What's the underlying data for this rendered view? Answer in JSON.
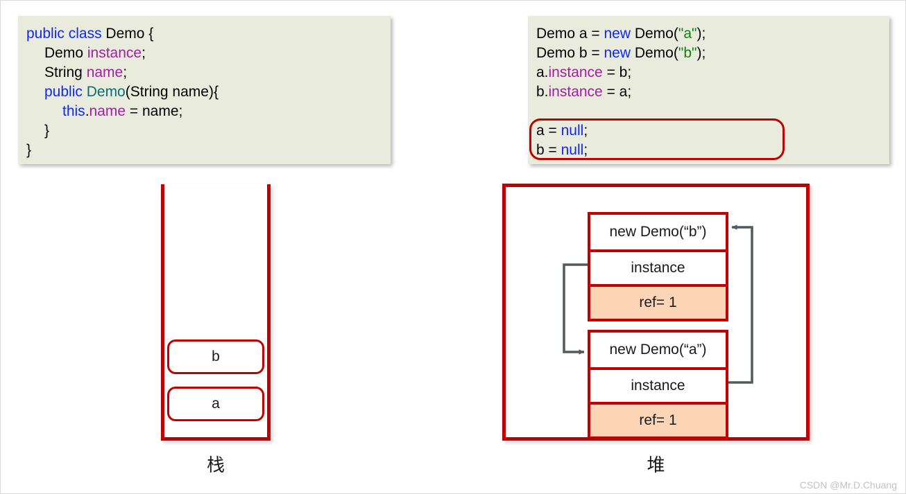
{
  "code_left": {
    "name": "demo-class-definition",
    "lines": [
      {
        "indent": 0,
        "tokens": [
          {
            "t": "public",
            "c": "kw"
          },
          {
            "t": " ",
            "c": ""
          },
          {
            "t": "class",
            "c": "kw"
          },
          {
            "t": " Demo {",
            "c": ""
          }
        ]
      },
      {
        "indent": 1,
        "tokens": [
          {
            "t": "Demo ",
            "c": ""
          },
          {
            "t": "instance",
            "c": "fld"
          },
          {
            "t": ";",
            "c": ""
          }
        ]
      },
      {
        "indent": 1,
        "tokens": [
          {
            "t": "String ",
            "c": ""
          },
          {
            "t": "name",
            "c": "fld"
          },
          {
            "t": ";",
            "c": ""
          }
        ]
      },
      {
        "indent": 1,
        "tokens": [
          {
            "t": "public",
            "c": "kw"
          },
          {
            "t": " ",
            "c": ""
          },
          {
            "t": "Demo",
            "c": "type"
          },
          {
            "t": "(String name){",
            "c": ""
          }
        ]
      },
      {
        "indent": 2,
        "tokens": [
          {
            "t": "this",
            "c": "kw"
          },
          {
            "t": ".",
            "c": ""
          },
          {
            "t": "name",
            "c": "fld"
          },
          {
            "t": " = name;",
            "c": ""
          }
        ]
      },
      {
        "indent": 1,
        "tokens": [
          {
            "t": "}",
            "c": ""
          }
        ]
      },
      {
        "indent": 0,
        "tokens": [
          {
            "t": "}",
            "c": ""
          }
        ]
      }
    ]
  },
  "code_right": {
    "name": "demo-usage-snippet",
    "lines": [
      {
        "indent": 0,
        "tokens": [
          {
            "t": "Demo a = ",
            "c": ""
          },
          {
            "t": "new",
            "c": "kw"
          },
          {
            "t": " Demo(",
            "c": ""
          },
          {
            "t": "\"a\"",
            "c": "str"
          },
          {
            "t": ");",
            "c": ""
          }
        ]
      },
      {
        "indent": 0,
        "tokens": [
          {
            "t": "Demo b = ",
            "c": ""
          },
          {
            "t": "new",
            "c": "kw"
          },
          {
            "t": " Demo(",
            "c": ""
          },
          {
            "t": "\"b\"",
            "c": "str"
          },
          {
            "t": ");",
            "c": ""
          }
        ]
      },
      {
        "indent": 0,
        "tokens": [
          {
            "t": "a.",
            "c": ""
          },
          {
            "t": "instance",
            "c": "fld"
          },
          {
            "t": " = b;",
            "c": ""
          }
        ]
      },
      {
        "indent": 0,
        "tokens": [
          {
            "t": "b.",
            "c": ""
          },
          {
            "t": "instance",
            "c": "fld"
          },
          {
            "t": " = a;",
            "c": ""
          }
        ]
      },
      {
        "indent": 0,
        "tokens": [
          {
            "t": " ",
            "c": ""
          }
        ]
      },
      {
        "indent": 0,
        "tokens": [
          {
            "t": "a = ",
            "c": ""
          },
          {
            "t": "null",
            "c": "kw"
          },
          {
            "t": ";",
            "c": ""
          }
        ]
      },
      {
        "indent": 0,
        "tokens": [
          {
            "t": "b = ",
            "c": ""
          },
          {
            "t": "null",
            "c": "kw"
          },
          {
            "t": ";",
            "c": ""
          }
        ]
      }
    ],
    "highlight_note": "a = null; b = null;"
  },
  "stack": {
    "label": "栈",
    "cells": [
      {
        "name": "stack-cell-b",
        "value": "b"
      },
      {
        "name": "stack-cell-a",
        "value": "a"
      }
    ]
  },
  "heap": {
    "label": "堆",
    "objects": [
      {
        "name": "heap-object-b",
        "title": "new Demo(“b”)",
        "field": "instance",
        "ref": "ref= 1"
      },
      {
        "name": "heap-object-a",
        "title": "new Demo(“a”)",
        "field": "instance",
        "ref": "ref= 1"
      }
    ],
    "arrows": [
      {
        "name": "arrow-b-instance-to-a",
        "from": "heap-object-b.instance",
        "to": "heap-object-a.title"
      },
      {
        "name": "arrow-a-instance-to-b",
        "from": "heap-object-a.instance",
        "to": "heap-object-b.title"
      }
    ]
  },
  "colors": {
    "code_background": "#E9ECDC",
    "keyword": "#1028F0",
    "field": "#A020A0",
    "type": "#0B6B76",
    "string": "#108010",
    "box_border": "#C00000",
    "ref_fill": "#FBD5B5",
    "arrow": "#54595C"
  },
  "watermark": "CSDN @Mr.D.Chuang"
}
